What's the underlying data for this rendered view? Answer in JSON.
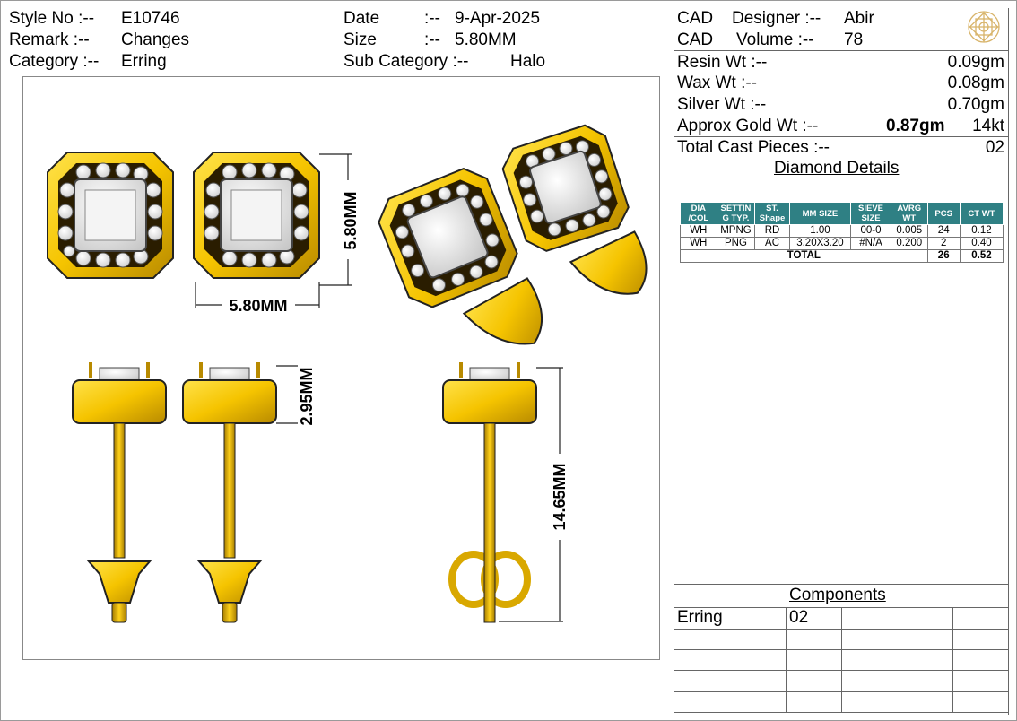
{
  "header": {
    "style_no_label": "Style No :--",
    "style_no": "E10746",
    "remark_label": "Remark  :--",
    "remark": "Changes",
    "category_label": "Category :--",
    "category": "Erring",
    "date_label": "Date",
    "date_sep": ":--",
    "date": "9-Apr-2025",
    "size_label": "Size",
    "size_sep": ":--",
    "size": "5.80MM",
    "subcat_label": "Sub Category :--",
    "subcat": "Halo"
  },
  "cad": {
    "designer_prefix": "CAD",
    "designer_label": "Designer :--",
    "designer": "Abir",
    "volume_prefix": "CAD",
    "volume_label": "Volume  :--",
    "volume": "78"
  },
  "weights": {
    "resin_label": "Resin Wt :--",
    "resin": "0.09gm",
    "wax_label": "Wax   Wt :--",
    "wax": "0.08gm",
    "silver_label": "Silver Wt :--",
    "silver": "0.70gm",
    "gold_label": "Approx Gold Wt :--",
    "gold": "0.87gm",
    "gold_karat": "14kt",
    "cast_label": "Total Cast Pieces :--",
    "cast": "02"
  },
  "diamond": {
    "title": "Diamond Details",
    "headers": [
      "DIA /COL",
      "SETTIN G TYP.",
      "ST. Shape",
      "MM SIZE",
      "SIEVE SIZE",
      "AVRG WT",
      "PCS",
      "CT WT"
    ],
    "rows": [
      [
        "WH",
        "MPNG",
        "RD",
        "1.00",
        "00-0",
        "0.005",
        "24",
        "0.12"
      ],
      [
        "WH",
        "PNG",
        "AC",
        "3.20X3.20",
        "#N/A",
        "0.200",
        "2",
        "0.40"
      ]
    ],
    "total_label": "TOTAL",
    "total_pcs": "26",
    "total_ct": "0.52"
  },
  "drawing": {
    "dim_width": "5.80MM",
    "dim_height": "5.80MM",
    "dim_depth": "2.95MM",
    "dim_length": "14.65MM"
  },
  "components": {
    "title": "Components",
    "rows": [
      {
        "name": "Erring",
        "qty": "02"
      }
    ]
  },
  "colors": {
    "gold": "#f5c400",
    "gold_dark": "#8a6a00",
    "table_header": "#2f8084",
    "logo": "#d8b46a"
  }
}
